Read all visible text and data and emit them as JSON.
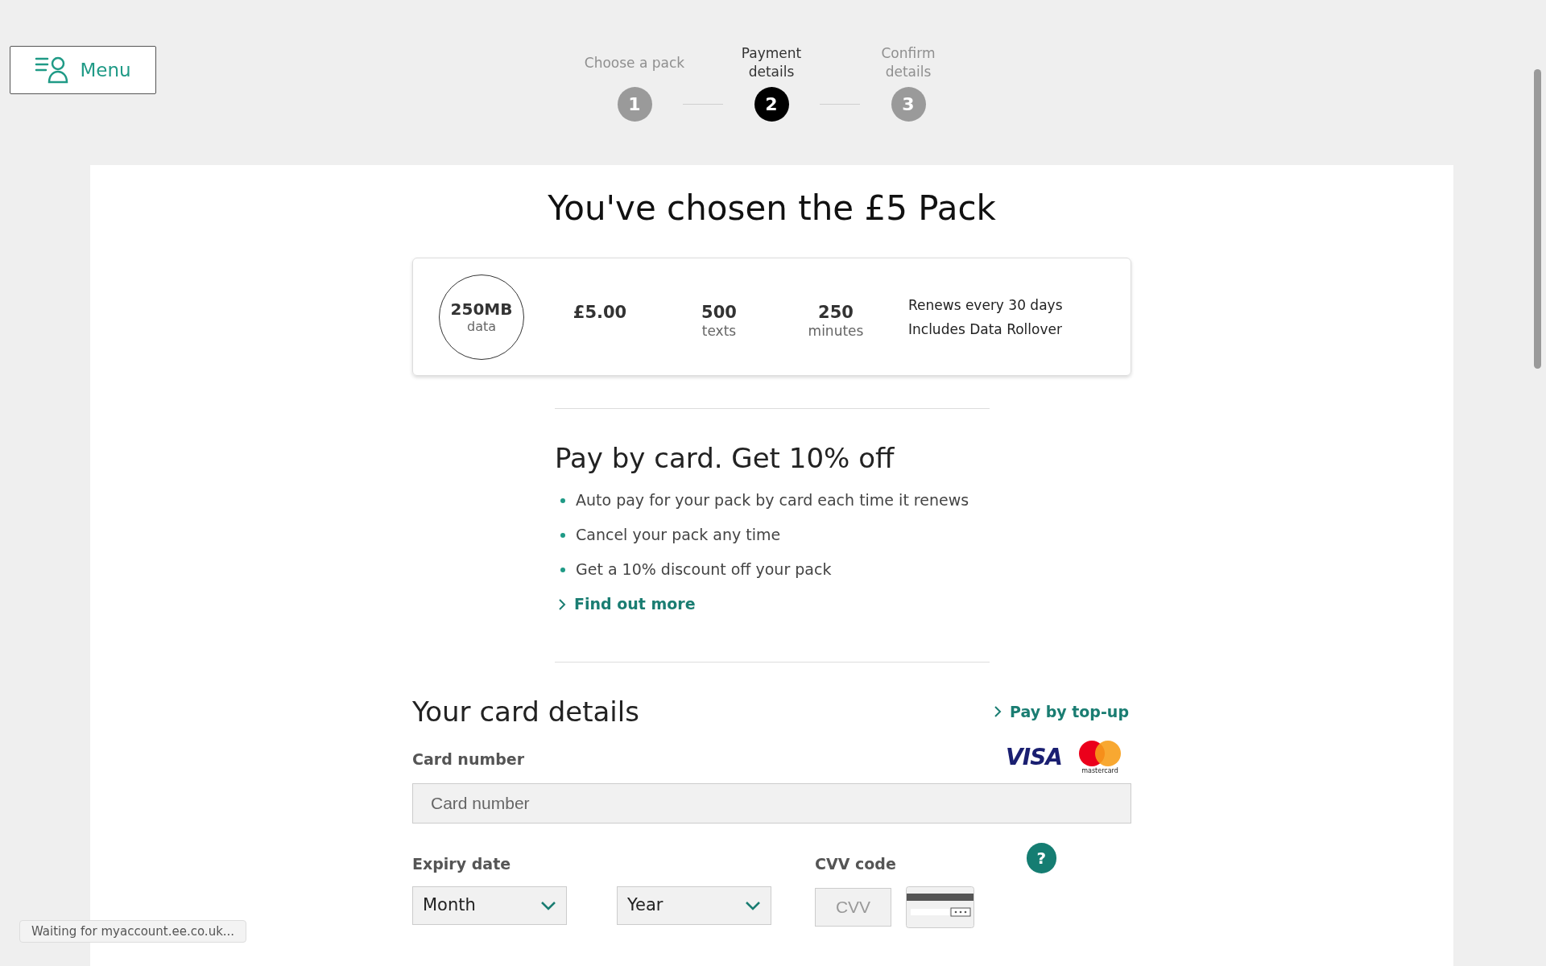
{
  "menu_button": {
    "label": "Menu"
  },
  "steps": [
    {
      "label": "Choose a pack",
      "number": "1",
      "selected": false
    },
    {
      "label": "Payment details",
      "number": "2",
      "selected": true
    },
    {
      "label": "Confirm details",
      "number": "3",
      "selected": false
    }
  ],
  "title": "You've chosen the £5 Pack",
  "pack": {
    "data": "250MB",
    "data_unit": "data",
    "price": "£5.00",
    "texts": "500",
    "texts_unit": "texts",
    "minutes": "250",
    "minutes_unit": "minutes",
    "notes": [
      "Renews every 30 days",
      "Includes Data Rollover"
    ]
  },
  "offer": {
    "heading": "Pay by card. Get 10% off",
    "bullets": [
      "Auto pay for your pack by card each time it renews",
      "Cancel your pack any time",
      "Get a 10% discount off your pack"
    ],
    "link": "Find out more"
  },
  "card_details": {
    "heading": "Your card details",
    "switch_link": "Pay by top-up",
    "card_number_label": "Card number",
    "card_logos": [
      "VISA",
      "mastercard"
    ],
    "card_number_placeholder": "Card number",
    "expiry_label": "Expiry date",
    "month": "Month",
    "year": "Year",
    "cvv_label": "CVV code",
    "help": "?",
    "cvv_placeholder": "CVV"
  },
  "status_bar": "Waiting for myaccount.ee.co.uk..."
}
